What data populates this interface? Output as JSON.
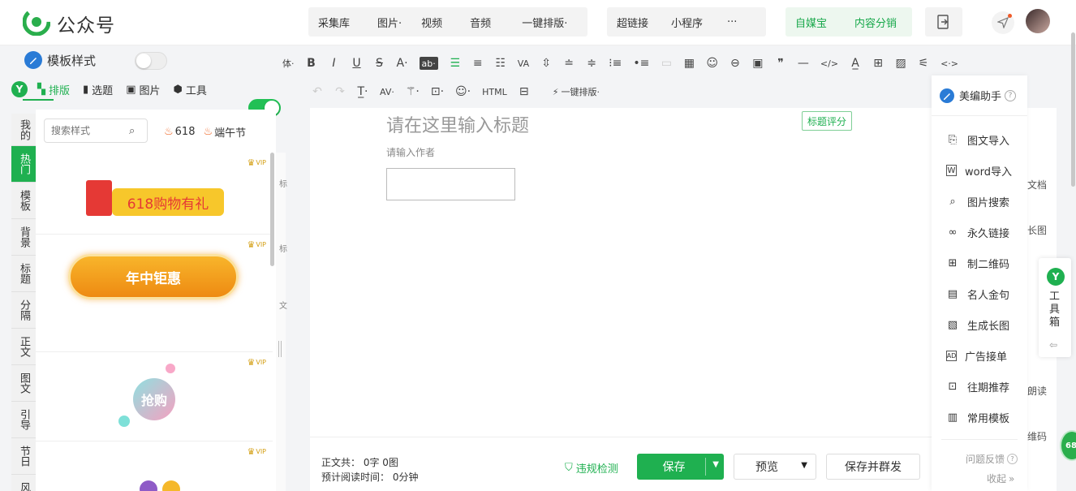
{
  "header": {
    "app_title": "公众号",
    "menu_items": [
      "采集库",
      "图片·",
      "视频",
      "音频",
      "一键排版·"
    ],
    "menu_items2": [
      "超链接",
      "小程序",
      "···"
    ],
    "green_items": [
      "自媒宝",
      "内容分销"
    ]
  },
  "toolbar_row1": {
    "template_label": "模板样式",
    "font_partial": "体·",
    "items": [
      "B",
      "I",
      "U",
      "S",
      "A·",
      "ab·"
    ]
  },
  "toolbar_row2": {
    "tabs": [
      {
        "label": "排版",
        "active": true
      },
      {
        "label": "选题"
      },
      {
        "label": "图片"
      },
      {
        "label": "工具"
      }
    ],
    "one_click": "一键排版·"
  },
  "left_tabs": [
    "我的",
    "热门",
    "模板",
    "背景",
    "标题",
    "分隔",
    "正文",
    "图文",
    "引导",
    "节日",
    "风格"
  ],
  "left_panel": {
    "search_placeholder": "搜索样式",
    "tags": [
      "618",
      "端午节"
    ],
    "cards": [
      {
        "text": "618购物有礼",
        "badge": "VIP"
      },
      {
        "text": "年中钜惠",
        "badge": "VIP"
      },
      {
        "text": "抢购",
        "badge": "VIP"
      },
      {
        "text": "",
        "badge": "VIP"
      }
    ]
  },
  "editor": {
    "title_placeholder": "请在这里输入标题",
    "title_score": "标题评分",
    "author_placeholder": "请输入作者"
  },
  "footer": {
    "word_count": "正文共： 0字 0图",
    "read_time": "预计阅读时间： 0分钟",
    "violation_check": "违规检测",
    "save": "保存",
    "preview": "预览",
    "save_publish": "保存并群发"
  },
  "side_panel": {
    "title": "美编助手",
    "items": [
      {
        "label": "图文导入",
        "icon": "import-doc-icon"
      },
      {
        "label": "word导入",
        "icon": "word-icon"
      },
      {
        "label": "图片搜索",
        "icon": "image-search-icon"
      },
      {
        "label": "永久链接",
        "icon": "link-icon"
      },
      {
        "label": "制二维码",
        "icon": "qrcode-icon"
      },
      {
        "label": "名人金句",
        "icon": "quote-icon"
      },
      {
        "label": "生成长图",
        "icon": "long-image-icon"
      },
      {
        "label": "广告接单",
        "icon": "ad-icon"
      },
      {
        "label": "往期推荐",
        "icon": "recommend-icon"
      },
      {
        "label": "常用模板",
        "icon": "template-icon"
      }
    ],
    "feedback": "问题反馈",
    "collapse": "收起"
  },
  "right_strip": {
    "labels": [
      "文档",
      "长图",
      "朗读",
      "维码"
    ],
    "toolbox": "工具箱",
    "badge": "68"
  },
  "mid_strip": [
    "标",
    "标",
    "文"
  ]
}
